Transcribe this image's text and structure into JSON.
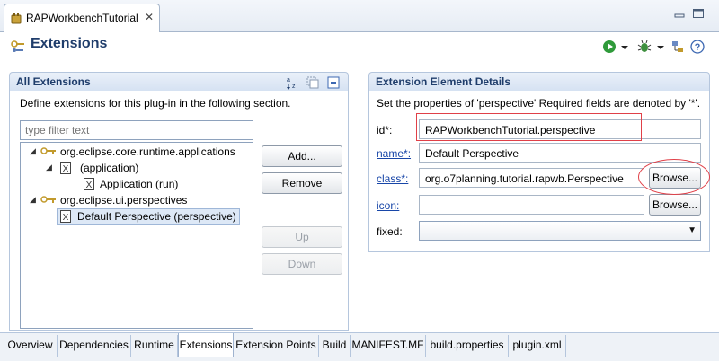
{
  "editor": {
    "tab_title": "RAPWorkbenchTutorial",
    "tab_close": "✕"
  },
  "header": {
    "title": "Extensions",
    "tools": [
      "run-icon",
      "dropdown-icon",
      "debug-icon",
      "dropdown-icon",
      "export-icon",
      "help-icon"
    ],
    "help_label": "?"
  },
  "all_extensions": {
    "title": "All Extensions",
    "description": "Define extensions for this plug-in in the following section.",
    "filter_placeholder": "type filter text",
    "tree": [
      {
        "label": "org.eclipse.core.runtime.applications",
        "level": 0,
        "expanded": true,
        "icon": "extension-point-icon"
      },
      {
        "label": "(application)",
        "level": 1,
        "expanded": true,
        "icon": "element-icon"
      },
      {
        "label": "Application (run)",
        "level": 2,
        "expanded": false,
        "icon": "element-icon"
      },
      {
        "label": "org.eclipse.ui.perspectives",
        "level": 0,
        "expanded": true,
        "icon": "extension-point-icon"
      },
      {
        "label": "Default Perspective (perspective)",
        "level": 1,
        "expanded": false,
        "icon": "element-icon",
        "selected": true
      }
    ],
    "buttons": {
      "add": "Add...",
      "remove": "Remove",
      "up": "Up",
      "down": "Down"
    }
  },
  "details": {
    "title": "Extension Element Details",
    "description": "Set the properties of 'perspective' Required fields are denoted by '*'.",
    "fields": {
      "id_label": "id*:",
      "id_value": "RAPWorkbenchTutorial.perspective",
      "name_label": "name*:",
      "name_value": "Default Perspective",
      "class_label": "class*:",
      "class_value": "org.o7planning.tutorial.rapwb.Perspective",
      "icon_label": "icon:",
      "icon_value": "",
      "fixed_label": "fixed:",
      "fixed_value": ""
    },
    "browse_label": "Browse..."
  },
  "page_tabs": [
    {
      "label": "Overview",
      "active": false
    },
    {
      "label": "Dependencies",
      "active": false
    },
    {
      "label": "Runtime",
      "active": false
    },
    {
      "label": "Extensions",
      "active": true
    },
    {
      "label": "Extension Points",
      "active": false
    },
    {
      "label": "Build",
      "active": false
    },
    {
      "label": "MANIFEST.MF",
      "active": false
    },
    {
      "label": "build.properties",
      "active": false
    },
    {
      "label": "plugin.xml",
      "active": false
    }
  ],
  "colors": {
    "header_title": "#1f3d6b",
    "link": "#1846a8",
    "annotation": "#e04048",
    "selection": "#dde8f6"
  }
}
